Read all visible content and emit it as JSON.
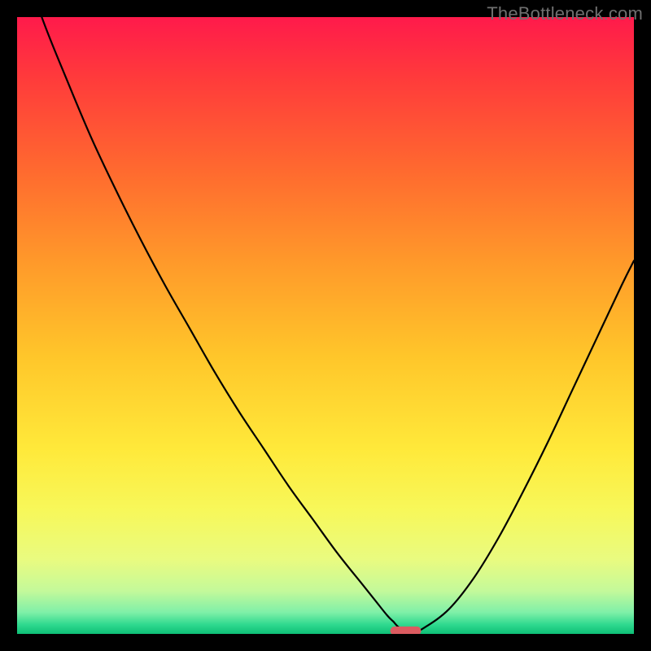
{
  "watermark": "TheBottleneck.com",
  "chart_data": {
    "type": "line",
    "title": "",
    "xlabel": "",
    "ylabel": "",
    "xlim": [
      0,
      100
    ],
    "ylim": [
      0,
      100
    ],
    "x": [
      0,
      4,
      8,
      12,
      16,
      20,
      24,
      28,
      32,
      36,
      40,
      44,
      48,
      52,
      56,
      58,
      60,
      61,
      62,
      64,
      66,
      70,
      74,
      78,
      82,
      86,
      90,
      94,
      98,
      100
    ],
    "values": [
      112,
      100,
      90,
      80.5,
      72,
      64,
      56.5,
      49.5,
      42.5,
      36,
      30,
      24,
      18.5,
      13,
      8,
      5.5,
      3,
      2,
      1,
      0.2,
      1,
      4,
      9,
      15.5,
      23,
      31,
      39.5,
      48,
      56.5,
      60.5
    ],
    "marker": {
      "x": 63,
      "y": 0.5,
      "w": 5,
      "h": 1.4
    },
    "background": {
      "type": "vertical-gradient",
      "stops": [
        {
          "offset": 0.0,
          "color": "#ff1a4b"
        },
        {
          "offset": 0.1,
          "color": "#ff3b3b"
        },
        {
          "offset": 0.25,
          "color": "#ff6a2f"
        },
        {
          "offset": 0.4,
          "color": "#ff9a2a"
        },
        {
          "offset": 0.55,
          "color": "#ffc62a"
        },
        {
          "offset": 0.7,
          "color": "#ffe93a"
        },
        {
          "offset": 0.8,
          "color": "#f7f85a"
        },
        {
          "offset": 0.88,
          "color": "#e9fb80"
        },
        {
          "offset": 0.93,
          "color": "#c4f99a"
        },
        {
          "offset": 0.965,
          "color": "#7ff0a8"
        },
        {
          "offset": 0.985,
          "color": "#2fd98f"
        },
        {
          "offset": 1.0,
          "color": "#0dbf76"
        }
      ]
    }
  }
}
